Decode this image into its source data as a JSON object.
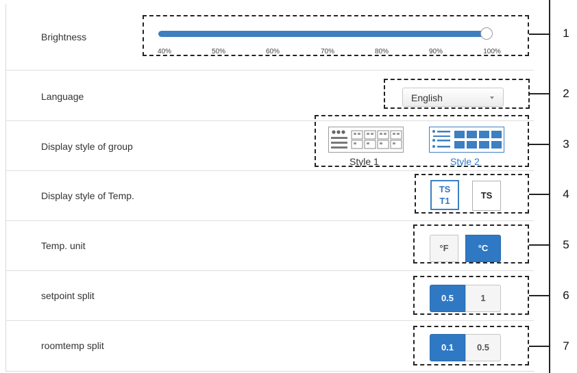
{
  "settings": {
    "brightness": {
      "label": "Brightness",
      "value_percent": 100,
      "ticks": [
        "40%",
        "50%",
        "60%",
        "70%",
        "80%",
        "90%",
        "100%"
      ]
    },
    "language": {
      "label": "Language",
      "selected": "English"
    },
    "group_style": {
      "label": "Display style of group",
      "options": [
        "Style 1",
        "Style 2"
      ],
      "selected": "Style 2"
    },
    "temp_style": {
      "label": "Display style of Temp.",
      "options": [
        {
          "line1": "TS",
          "line2": "T1"
        },
        {
          "line1": "TS",
          "line2": ""
        }
      ],
      "selected_index": 0
    },
    "temp_unit": {
      "label": "Temp. unit",
      "options": [
        "°F",
        "°C"
      ],
      "selected": "°C"
    },
    "setpoint_split": {
      "label": "setpoint split",
      "options": [
        "0.5",
        "1"
      ],
      "selected": "0.5"
    },
    "roomtemp_split": {
      "label": "roomtemp split",
      "options": [
        "0.1",
        "0.5"
      ],
      "selected": "0.1"
    }
  },
  "callouts": [
    "1",
    "2",
    "3",
    "4",
    "5",
    "6",
    "7"
  ],
  "colors": {
    "accent": "#2f78c4",
    "slider": "#3d7fc1",
    "border": "#dedede"
  }
}
